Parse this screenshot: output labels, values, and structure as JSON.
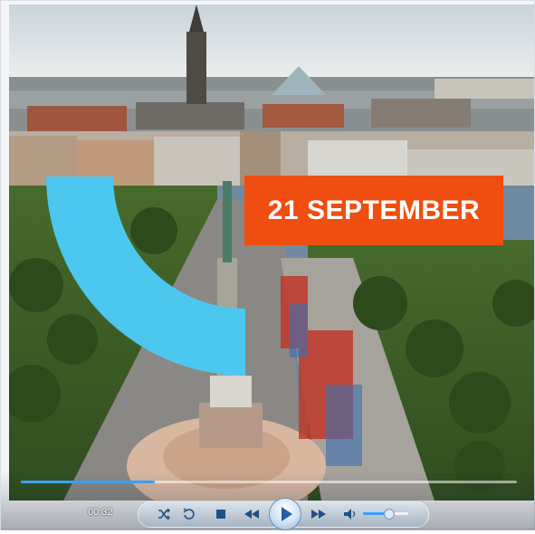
{
  "player": {
    "date_text": "21 SEPTEMBER",
    "elapsed_time": "00:32",
    "progress_fraction": 0.27,
    "volume_fraction": 0.55,
    "accent_color": "#3aa0ff",
    "date_badge_color": "#f04e10",
    "shape_color": "#4cc8f0"
  },
  "controls": {
    "icons": [
      "shuffle-icon",
      "repeat-icon",
      "stop-icon",
      "previous-icon",
      "play-icon",
      "next-icon",
      "volume-icon"
    ]
  }
}
